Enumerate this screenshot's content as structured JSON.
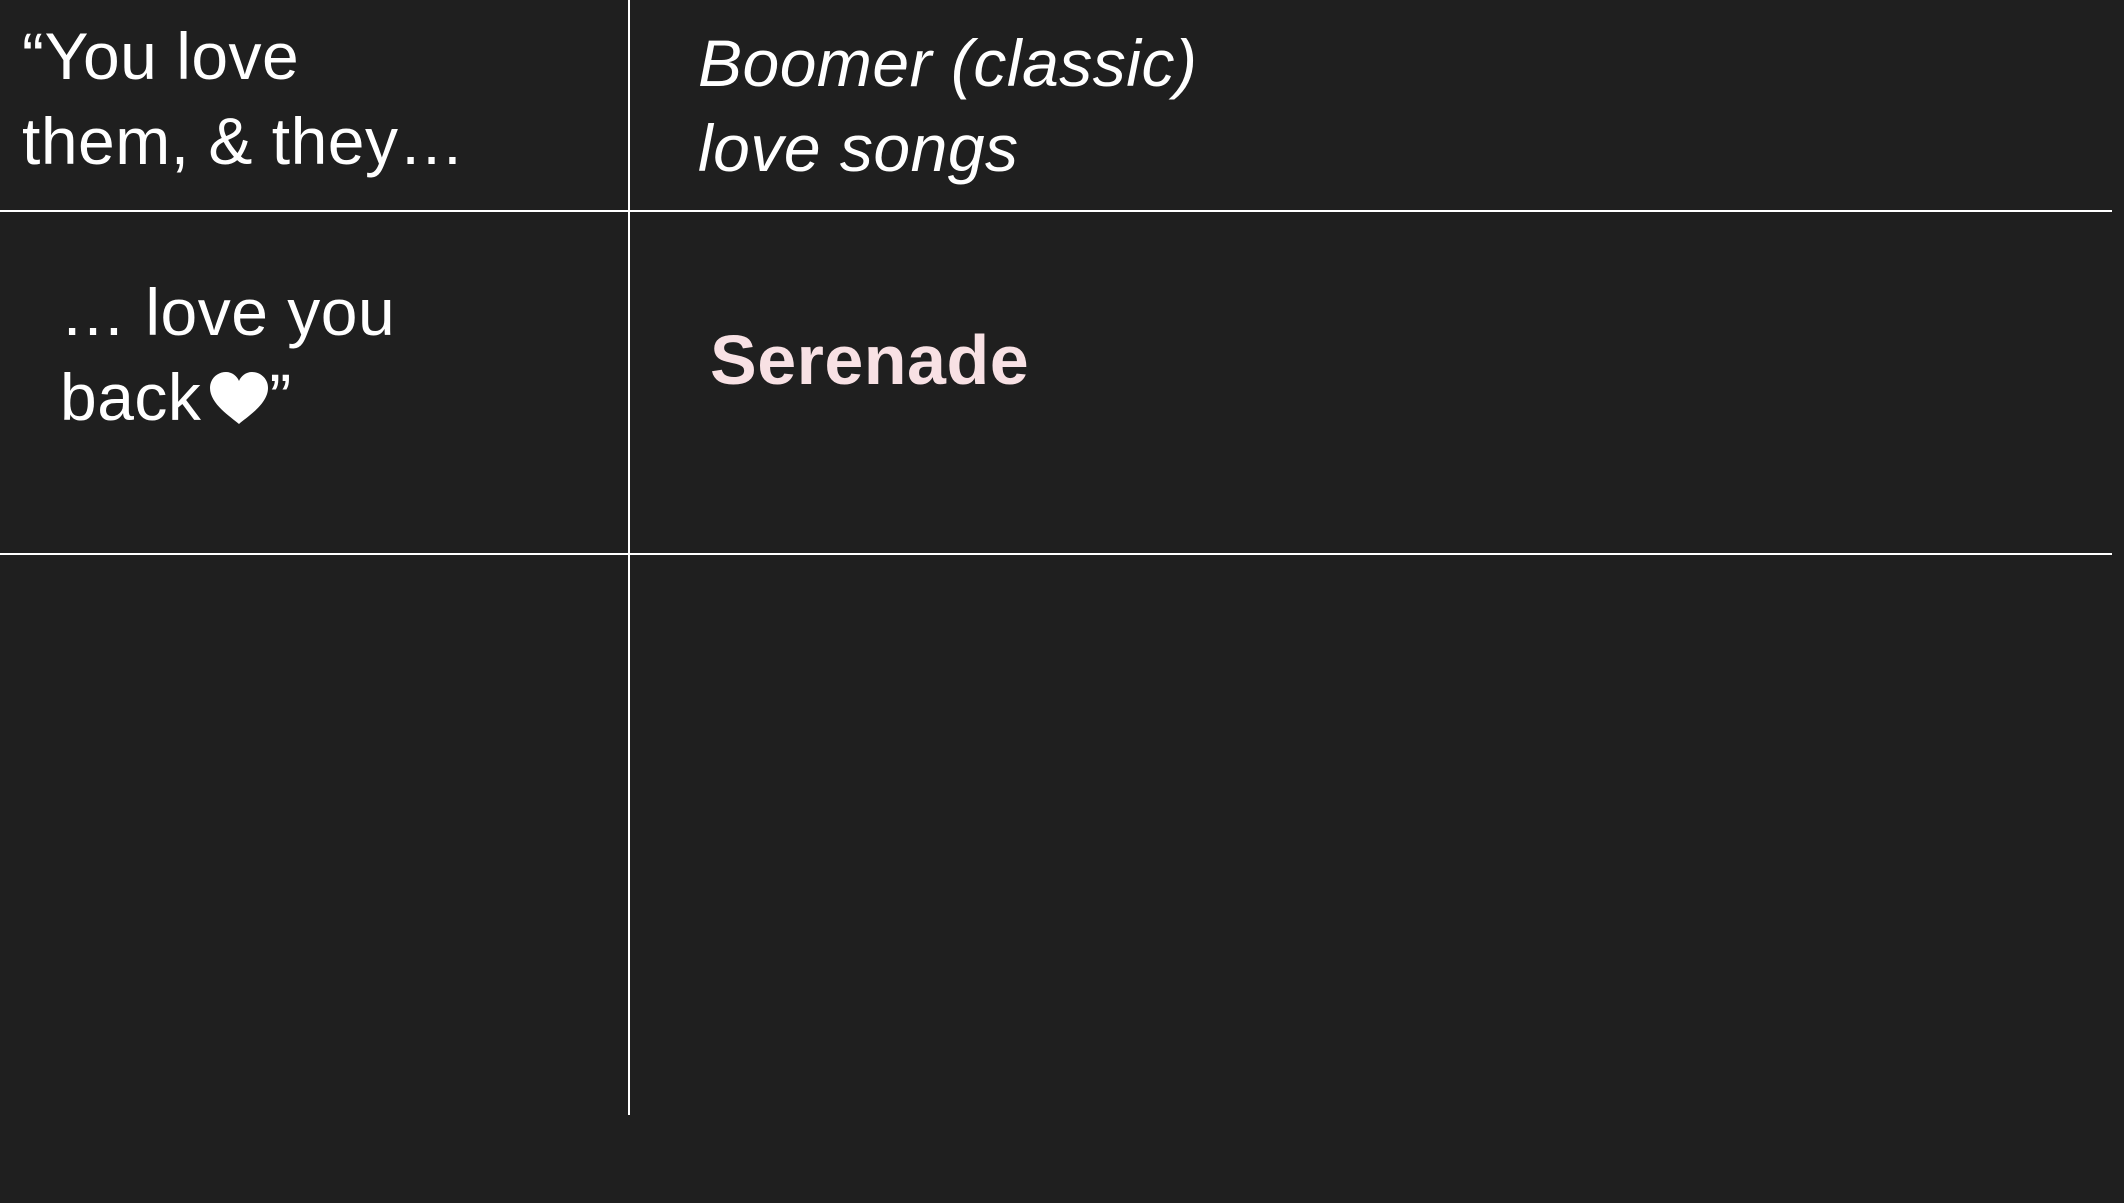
{
  "table": {
    "row1": {
      "left": {
        "line1": "“You love",
        "line2": "them, & they…"
      },
      "right": {
        "line1": "Boomer (classic)",
        "line2": "love songs"
      }
    },
    "row2": {
      "left": {
        "line1": "… love you",
        "line2_prefix": "back",
        "icon": "heart-icon",
        "line2_suffix": "”"
      },
      "right": {
        "label": "Serenade"
      }
    }
  },
  "colors": {
    "background": "#1f1f1f",
    "text": "#ffffff",
    "rules": "#ffffff",
    "highlight": "#f8e1e4"
  }
}
